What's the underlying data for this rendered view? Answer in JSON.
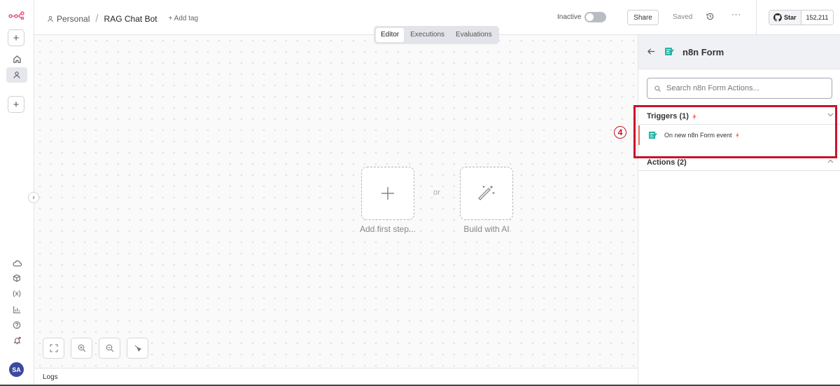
{
  "header": {
    "project": "Personal",
    "workflow_name": "RAG Chat Bot",
    "add_tag": "+ Add tag",
    "status": "Inactive",
    "share": "Share",
    "saved": "Saved",
    "github_star": "Star",
    "github_count": "152,211"
  },
  "tabs": [
    "Editor",
    "Executions",
    "Evaluations"
  ],
  "canvas": {
    "add_first_step": "Add first step...",
    "or": "or",
    "build_with_ai": "Build with AI"
  },
  "logs": "Logs",
  "user": {
    "initials": "SA"
  },
  "panel": {
    "title": "n8n Form",
    "search_placeholder": "Search n8n Form Actions...",
    "triggers_label": "Triggers (1)",
    "trigger_item": "On new n8n Form event",
    "actions_label": "Actions (2)"
  },
  "annotation": {
    "marker": "4",
    "color": "#c4162a"
  },
  "colors": {
    "accent": "#ff6d5a",
    "form_icon": "#27b3a4",
    "brand": "#ea4b71"
  }
}
